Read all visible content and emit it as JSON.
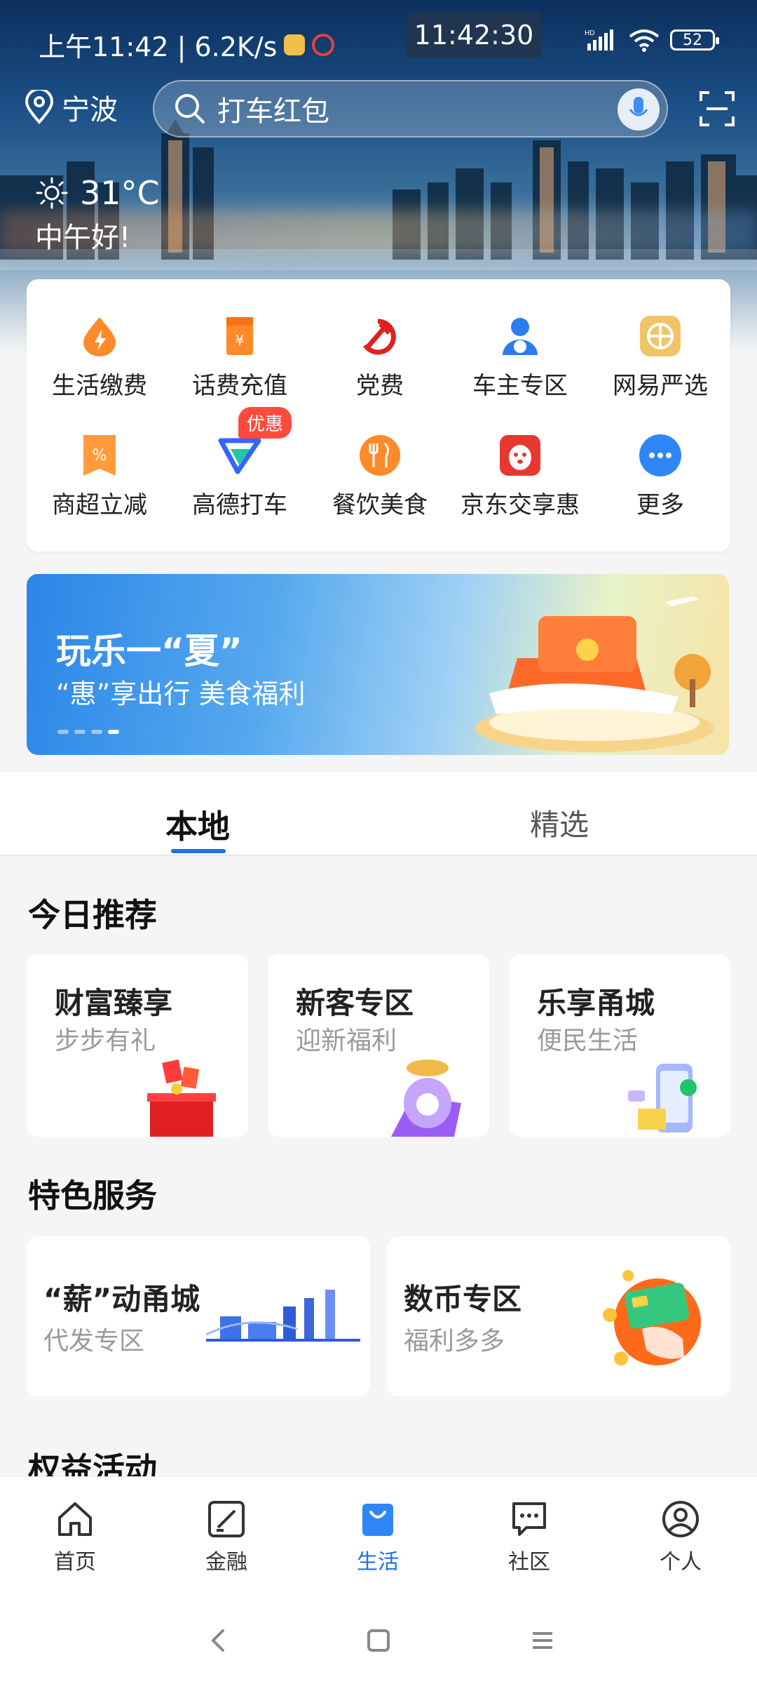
{
  "status": {
    "left_text": "上午11:42 | 6.2K/s",
    "clock": "11:42:30",
    "battery": "52"
  },
  "topbar": {
    "location": "宁波",
    "search_placeholder": "打车红包"
  },
  "weather": {
    "temp": "31°C",
    "greeting": "中午好!"
  },
  "services": [
    {
      "label": "生活缴费",
      "icon": "lightning-drop-icon",
      "color": "#ff8a2a"
    },
    {
      "label": "话费充值",
      "icon": "yuan-card-icon",
      "color": "#ff8a2a"
    },
    {
      "label": "党费",
      "icon": "party-emblem-icon",
      "color": "#e02020"
    },
    {
      "label": "车主专区",
      "icon": "driver-icon",
      "color": "#2b7cf0"
    },
    {
      "label": "网易严选",
      "icon": "netease-icon",
      "color": "#f0c56a"
    },
    {
      "label": "商超立减",
      "icon": "discount-ribbon-icon",
      "color": "#ff9b3a"
    },
    {
      "label": "高德打车",
      "icon": "amap-taxi-icon",
      "color": "#3366ff"
    },
    {
      "label": "餐饮美食",
      "icon": "fork-knife-icon",
      "color": "#ff8a2a"
    },
    {
      "label": "京东交享惠",
      "icon": "jd-dog-icon",
      "color": "#e8372f"
    },
    {
      "label": "更多",
      "icon": "more-icon",
      "color": "#2f86f6"
    }
  ],
  "services_badge": "优惠",
  "banner": {
    "title": "玩乐一“夏”",
    "subtitle": "“惠”享出行 美食福利"
  },
  "tabs": {
    "local": "本地",
    "featured": "精选"
  },
  "today": {
    "title": "今日推荐",
    "cards": [
      {
        "title": "财富臻享",
        "sub": "步步有礼"
      },
      {
        "title": "新客专区",
        "sub": "迎新福利"
      },
      {
        "title": "乐享甬城",
        "sub": "便民生活"
      }
    ]
  },
  "special": {
    "title": "特色服务",
    "cards": [
      {
        "title": "“薪”动甬城",
        "sub": "代发专区"
      },
      {
        "title": "数币专区",
        "sub": "福利多多"
      }
    ]
  },
  "rights": {
    "title": "权益活动"
  },
  "bottom_nav": [
    {
      "label": "首页",
      "icon": "home-icon"
    },
    {
      "label": "金融",
      "icon": "finance-icon"
    },
    {
      "label": "生活",
      "icon": "shopping-bag-icon"
    },
    {
      "label": "社区",
      "icon": "chat-icon"
    },
    {
      "label": "个人",
      "icon": "person-icon"
    }
  ],
  "colors": {
    "accent": "#1f6fe5",
    "badge": "#ff4b3e"
  }
}
